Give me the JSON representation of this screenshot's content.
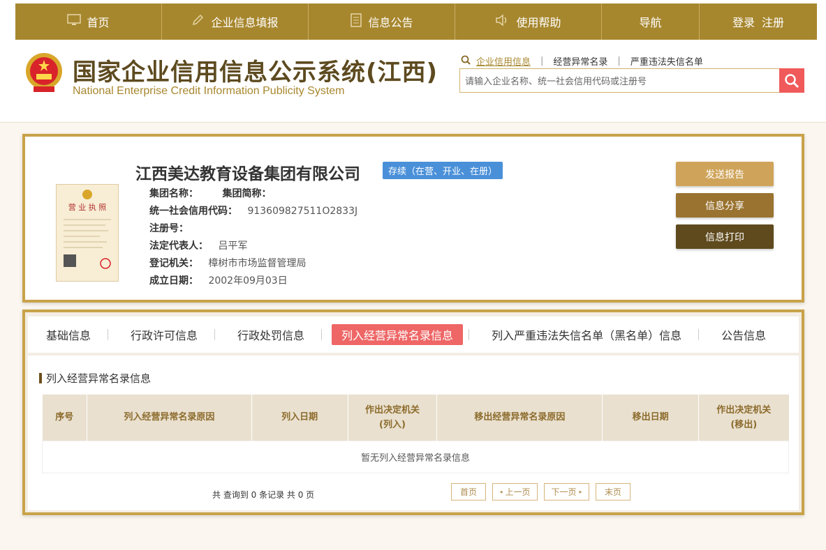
{
  "nav": {
    "items": [
      {
        "label": "首页",
        "icon": "monitor-icon"
      },
      {
        "label": "企业信息填报",
        "icon": "pen-icon"
      },
      {
        "label": "信息公告",
        "icon": "document-icon"
      },
      {
        "label": "使用帮助",
        "icon": "speaker-icon"
      },
      {
        "label": "导航"
      }
    ],
    "login": "登录",
    "register": "注册"
  },
  "header": {
    "title_cn": "国家企业信用信息公示系统(江西)",
    "title_en": "National Enterprise Credit Information Publicity System"
  },
  "search": {
    "tabs": [
      "企业信用信息",
      "经营异常名录",
      "严重违法失信名单"
    ],
    "placeholder": "请输入企业名称、统一社会信用代码或注册号"
  },
  "company": {
    "name": "江西美达教育设备集团有限公司",
    "status": "存续（在营、开业、在册）",
    "group_name_label": "集团名称：",
    "group_abbr_label": "集团简称：",
    "credit_code_label": "统一社会信用代码：",
    "credit_code": "913609827511O2833J",
    "reg_no_label": "注册号：",
    "legal_rep_label": "法定代表人：",
    "legal_rep": "吕平军",
    "authority_label": "登记机关：",
    "authority": "樟树市市场监督管理局",
    "established_label": "成立日期：",
    "established": "2002年09月03日"
  },
  "actions": {
    "send_report": "发送报告",
    "share": "信息分享",
    "print": "信息打印"
  },
  "tabs": [
    "基础信息",
    "行政许可信息",
    "行政处罚信息",
    "列入经营异常名录信息",
    "列入严重违法失信名单（黑名单）信息",
    "公告信息"
  ],
  "section": {
    "title": "列入经营异常名录信息",
    "columns": [
      "序号",
      "列入经营异常名录原因",
      "列入日期",
      "作出决定机关\n(列入)",
      "移出经营异常名录原因",
      "移出日期",
      "作出决定机关\n(移出)"
    ],
    "empty_text": "暂无列入经营异常名录信息"
  },
  "pagination": {
    "summary": "共 查询到 0 条记录 共 0 页",
    "first": "首页",
    "prev": "上一页",
    "next": "下一页",
    "last": "末页"
  },
  "colors": {
    "gold": "#a7872e",
    "card_border": "#c9a24a",
    "status_blue": "#4a90d9",
    "active_tab": "#ee6666",
    "search_btn": "#f05a5a"
  }
}
